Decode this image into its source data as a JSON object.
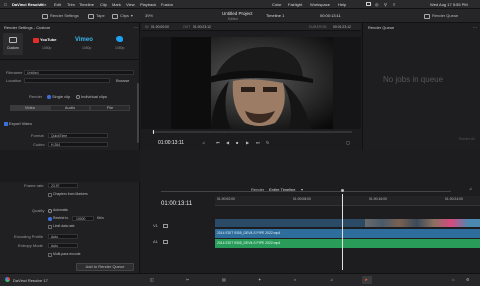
{
  "menubar": {
    "app": "DaVinci Resolve",
    "items": [
      "File",
      "Edit",
      "Trim",
      "Timeline",
      "Clip",
      "Mark",
      "View",
      "Playback",
      "Fusion"
    ],
    "right": [
      "Color",
      "Fairlight",
      "Workspace",
      "Help"
    ],
    "datetime": "Wed Aug 17 5:55 PM"
  },
  "toolbar": {
    "render_settings": "Render Settings",
    "tape": "Tape",
    "clips": "Clips",
    "zoom": "39%",
    "project_title": "Untitled Project",
    "edited": "Edited",
    "timeline_name": "Timeline 1",
    "timecode_top": "00:00:13:11",
    "render_queue": "Render Queue"
  },
  "left": {
    "header": "Render Settings - Custom",
    "presets": [
      "Custom",
      "YouTube",
      "Vimeo",
      "Twitter"
    ],
    "preset_sub": [
      "Custom",
      "1080p",
      "1080p",
      "1080p"
    ],
    "filename_label": "Filename",
    "filename_value": "Untitled",
    "location_label": "Location",
    "browse": "Browse",
    "render_label": "Render",
    "single_clip": "Single clip",
    "individual_clips": "Individual clips",
    "tabs": [
      "Video",
      "Audio",
      "File"
    ],
    "export_video": "Export Video",
    "format_label": "Format",
    "format_value": "QuickTime",
    "codec_label": "Codec",
    "codec_value": "H.264",
    "hw_accel": "Use hardware acceleration if available",
    "network_opt": "Network Optimization",
    "resolution_label": "Resolution",
    "resolution_value": "1920 x 1080 HD",
    "framerate_label": "Frame rate",
    "framerate_value": "23.97",
    "chapters": "Chapters from Markers",
    "quality_label": "Quality",
    "automatic": "Automatic",
    "restrict_to": "Restrict to",
    "restrict_value": "10000",
    "kbps": "Kb/s",
    "limit_keyframes": "Limit data rate",
    "encoding_profile_label": "Encoding Profile",
    "encoding_profile_value": "Auto",
    "entropy_label": "Entropy Mode",
    "entropy_value": "Auto",
    "multipass": "Multi-pass encode",
    "add_to_queue": "Add to Render Queue"
  },
  "viewer": {
    "src_in_label": "IN",
    "src_in": "01:00:00:00",
    "out_label": "OUT",
    "out": "01:00:23:12",
    "duration_label": "DURATION",
    "duration": "00:01:23:12",
    "timecode": "01:00:13:11"
  },
  "renderqueue": {
    "empty": "No jobs in queue",
    "render_all": "Render All"
  },
  "timeline": {
    "clip_index": "01",
    "clip_label": "V1",
    "clip_name": "H.264 Main L4.1",
    "render_label": "Render",
    "render_mode": "Entire Timeline",
    "timecode": "01:00:13:11",
    "ruler": [
      "01:00:00:00",
      "01:00:08:00",
      "01:00:16:00",
      "01:00:24:00"
    ],
    "v1_label": "V1",
    "a1_label": "A1",
    "audio_clip_1": "2014 EDIT 9305_DEVILS PIPE 2022.mp4",
    "audio_clip_2": "2014 EDIT 9305_DEVILS PIPE 2022.mp4"
  },
  "bottombar": {
    "app": "DaVinci Resolve 17"
  }
}
